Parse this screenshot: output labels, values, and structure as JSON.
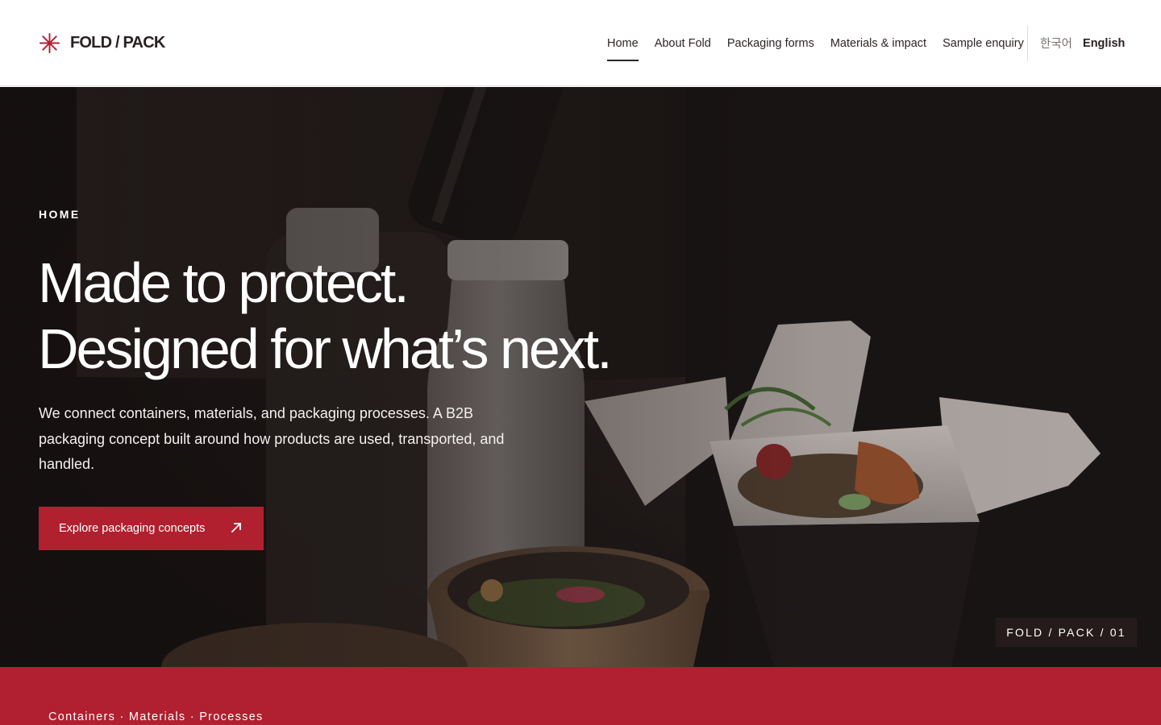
{
  "brand": {
    "logo_icon": "asterisk-icon",
    "name": "FOLD / PACK",
    "accent_color": "#b0202f"
  },
  "nav": {
    "items": [
      {
        "label": "Home",
        "active": true
      },
      {
        "label": "About Fold",
        "active": false
      },
      {
        "label": "Packaging forms",
        "active": false
      },
      {
        "label": "Materials & impact",
        "active": false
      },
      {
        "label": "Sample enquiry",
        "active": false
      }
    ],
    "languages": [
      {
        "label": "한국어",
        "active": false
      },
      {
        "label": "English",
        "active": true
      }
    ]
  },
  "hero": {
    "eyebrow": "HOME",
    "headline_line1": "Made to protect.",
    "headline_line2": "Designed for what’s next.",
    "lead": "We connect containers, materials, and packaging processes. A B2B packaging concept built around how products are used, transported, and handled.",
    "cta_label": "Explore packaging concepts",
    "cta_icon": "arrow-up-right-icon",
    "badge": "FOLD / PACK / 01"
  },
  "band": {
    "text": "Containers · Materials · Processes"
  }
}
